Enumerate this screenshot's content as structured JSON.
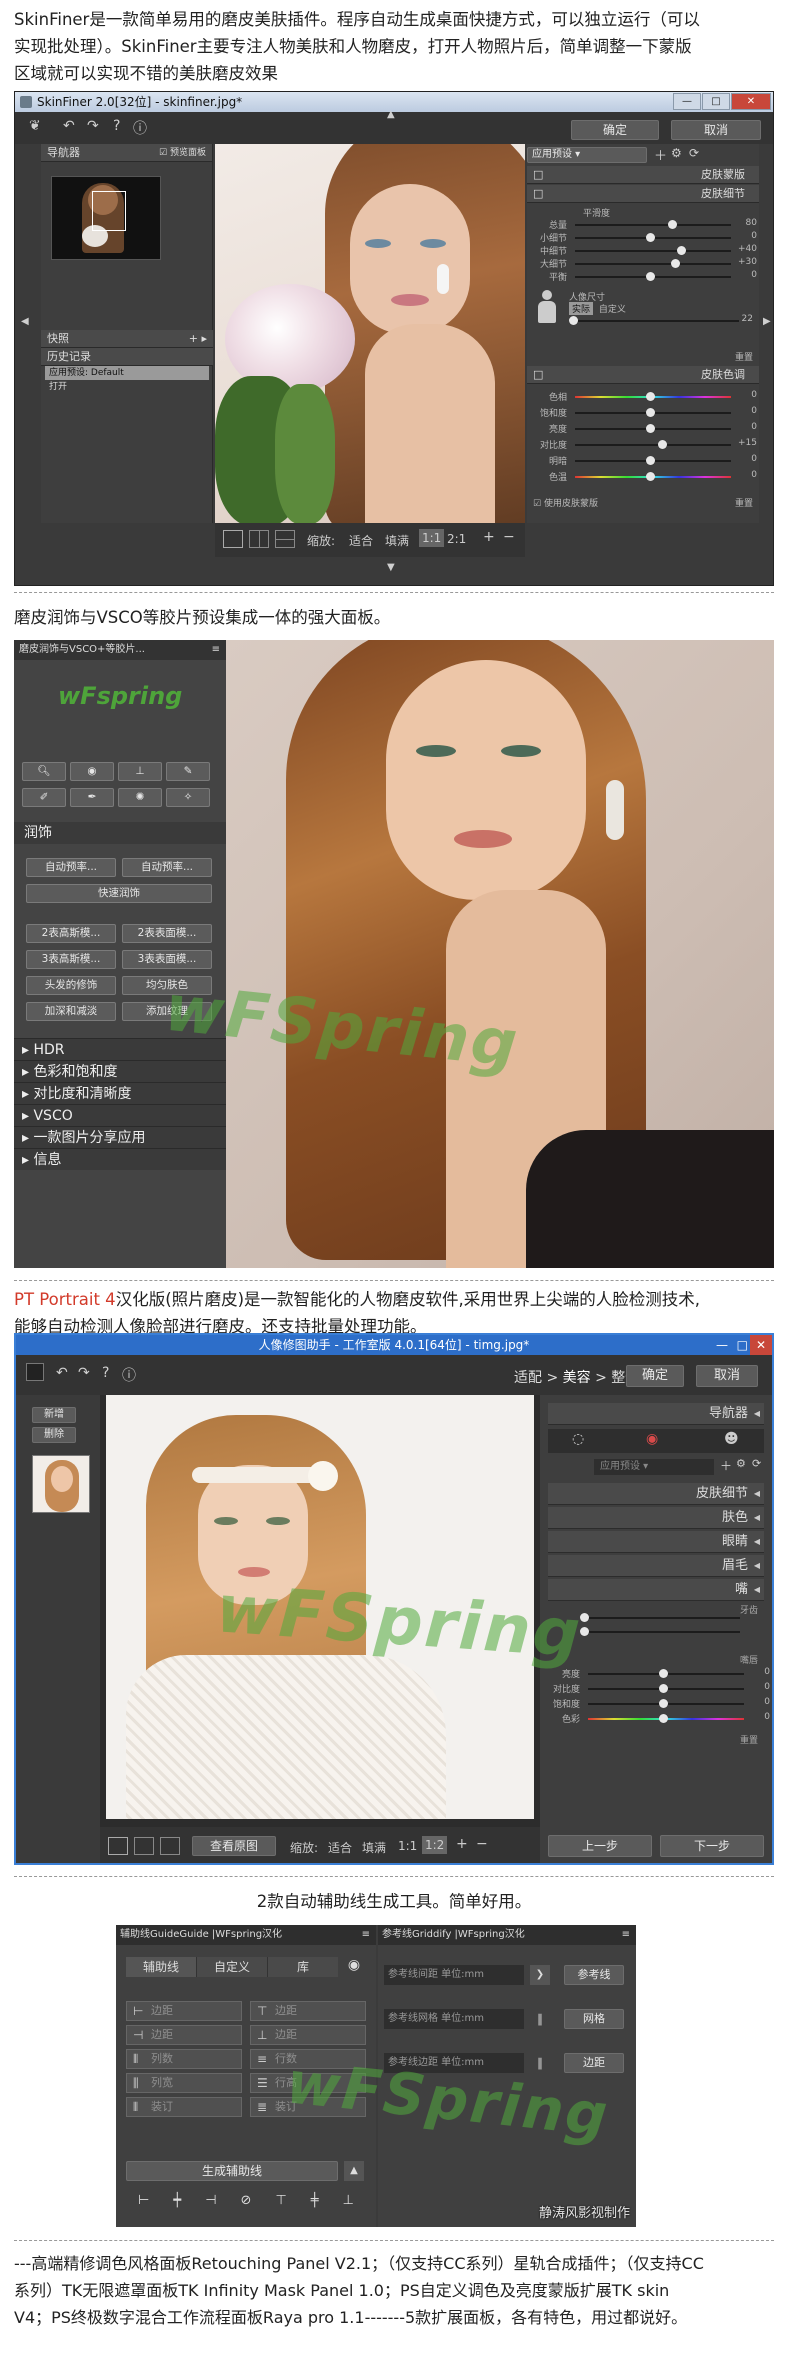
{
  "intro": {
    "skinfiner_1": "SkinFiner是一款简单易用的磨皮美肤插件。程序自动生成桌面快捷方式，可以独立运行（可以",
    "skinfiner_2": "实现批处理）。SkinFiner主要专注人物美肤和人物磨皮，打开人物照片后，简单调整一下蒙版",
    "skinfiner_3": "区域就可以实现不错的美肤磨皮效果",
    "vsco": "磨皮润饰与VSCO等胶片预设集成一体的强大面板。",
    "pt_red": "PT Portrait 4",
    "pt_1": "汉化版(照片磨皮)是一款智能化的人物磨皮软件,采用世界上尖端的人脸检测技术,",
    "pt_2": "能够自动检测人像脸部进行磨皮。还支持批量处理功能。",
    "guides": "2款自动辅助线生成工具。简单好用。",
    "footer_1": "---高端精修调色风格面板Retouching Panel V2.1；（仅支持CC系列）星轨合成插件；（仅支持CC",
    "footer_2": "系列）TK无限遮罩面板TK Infinity Mask Panel 1.0；PS自定义调色及亮度蒙版扩展TK skin",
    "footer_3": "V4；PS终极数字混合工作流程面板Raya pro 1.1-------5款扩展面板，各有特色，用过都说好。"
  },
  "shot1": {
    "window_title": "SkinFiner 2.0[32位] - skinfiner.jpg*",
    "confirm": "确定",
    "cancel": "取消",
    "navigator": "导航器",
    "preview_check": "预览面板",
    "snapshot": "快照",
    "history": "历史记录",
    "history_items": [
      "应用预设: Default",
      "打开"
    ],
    "preset_select": "应用预设",
    "skin_mask": "皮肤蒙版",
    "skin_detail": "皮肤细节",
    "smooth": "平滑度",
    "detail_sliders": [
      {
        "label": "总量",
        "value": "80",
        "pos": 0.62
      },
      {
        "label": "小细节",
        "value": "0",
        "pos": 0.48
      },
      {
        "label": "中细节",
        "value": "+40",
        "pos": 0.68
      },
      {
        "label": "大细节",
        "value": "+30",
        "pos": 0.64
      },
      {
        "label": "平衡",
        "value": "0",
        "pos": 0.48
      }
    ],
    "face_size": "人像尺寸",
    "face_opts": [
      "实际",
      "自定义"
    ],
    "face_value": "22",
    "reset": "重置",
    "skin_color": "皮肤色调",
    "color_sliders": [
      {
        "label": "色相",
        "value": "0",
        "pos": 0.48
      },
      {
        "label": "饱和度",
        "value": "0",
        "pos": 0.48
      },
      {
        "label": "亮度",
        "value": "0",
        "pos": 0.48
      },
      {
        "label": "对比度",
        "value": "+15",
        "pos": 0.56
      },
      {
        "label": "明暗",
        "value": "0",
        "pos": 0.48
      },
      {
        "label": "色温",
        "value": "0",
        "pos": 0.48
      }
    ],
    "use_mask": "使用皮肤蒙版",
    "reset2": "重置",
    "zoom_label": "缩放:",
    "zoom_fit": "适合",
    "zoom_fill": "填满",
    "zoom_11": "1:1",
    "zoom_21": "2:1"
  },
  "shot2": {
    "panel_title": "磨皮润饰与VSCO+等胶片...",
    "logo": "wFspring",
    "section": "润饰",
    "buttons": [
      [
        "自动预率...",
        "自动预率..."
      ],
      [
        "快速润饰"
      ],
      [
        "2表高斯模...",
        "2表表面模..."
      ],
      [
        "3表高斯模...",
        "3表表面模..."
      ],
      [
        "头发的修饰",
        "均匀肤色"
      ],
      [
        "加深和减淡",
        "添加纹理"
      ]
    ],
    "accordion": [
      "HDR",
      "色彩和饱和度",
      "对比度和清晰度",
      "VSCO",
      "一款图片分享应用",
      "信息"
    ],
    "watermark": "wFSpring"
  },
  "shot3": {
    "window_title": "人像修图助手 - 工作室版 4.0.1[64位] - timg.jpg*",
    "new": "新增",
    "delete": "删除",
    "crumb_1": "适配",
    "crumb_2": "美容",
    "crumb_3": "整形",
    "confirm": "确定",
    "cancel": "取消",
    "navigator": "导航器",
    "preset": "应用预设",
    "sections": [
      "皮肤细节",
      "肤色",
      "眼睛",
      "眉毛",
      "嘴"
    ],
    "teeth": "牙齿",
    "lips": "嘴唇",
    "lip_sliders": [
      {
        "label": "亮度",
        "value": "0",
        "pos": 0.48
      },
      {
        "label": "对比度",
        "value": "0",
        "pos": 0.48
      },
      {
        "label": "饱和度",
        "value": "0",
        "pos": 0.48
      },
      {
        "label": "色彩",
        "value": "0",
        "pos": 0.48
      }
    ],
    "reset": "重置",
    "view_original": "查看原图",
    "zoom_label": "缩放:",
    "zoom_fit": "适合",
    "zoom_fill": "填满",
    "zoom_11": "1:1",
    "zoom_12": "1:2",
    "prev": "上一步",
    "next": "下一步",
    "watermark": "wFSpring"
  },
  "shot4": {
    "left_title": "辅助线GuideGuide |WFspring汉化",
    "tabs": [
      "辅助线",
      "自定义",
      "库"
    ],
    "rows_left": [
      "边距",
      "边距",
      "列数",
      "列宽",
      "装订"
    ],
    "rows_right": [
      "边距",
      "边距",
      "行数",
      "行高",
      "装订"
    ],
    "generate": "生成辅助线",
    "right_title": "参考线Griddify |WFspring汉化",
    "ref_rows": [
      "参考线间距 单位:mm",
      "参考线网格 单位:mm",
      "参考线边距 单位:mm"
    ],
    "ref_buttons": [
      "参考线",
      "网格",
      "边距"
    ],
    "watermark": "wFSpring",
    "credit": "静涛风影视制作"
  }
}
